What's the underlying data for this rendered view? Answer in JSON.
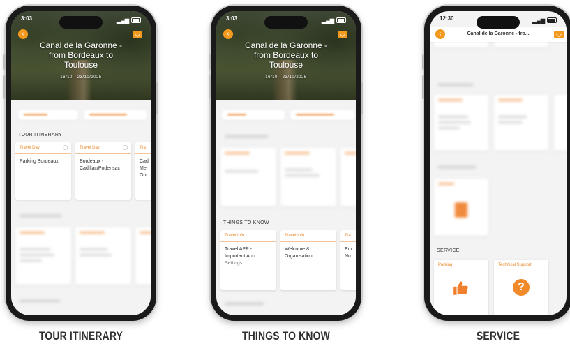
{
  "colors": {
    "accent": "#f39a1e",
    "card_head_text": "#e8892a",
    "caption": "#2f2f2f"
  },
  "phones": [
    {
      "status_time": "3:03",
      "hero_title": "Canal de la Garonne - from Bordeaux to Toulouse",
      "hero_dates": "16/10 - 23/10/2025",
      "section_label": "TOUR ITINERARY",
      "cards": [
        {
          "head": "Travel Day",
          "body": "Parking Bordeaux",
          "sub": ""
        },
        {
          "head": "Travel Day",
          "body": "Bordeaux - Cadillac/Podensac",
          "sub": ""
        },
        {
          "head": "Tra",
          "body": "Cad Mei Gor",
          "sub": ""
        }
      ],
      "caption": "TOUR ITINERARY"
    },
    {
      "status_time": "3:03",
      "hero_title": "Canal de la Garonne - from Bordeaux to Toulouse",
      "hero_dates": "16/10 - 23/10/2025",
      "section_label": "THINGS TO KNOW",
      "cards": [
        {
          "head": "Travel Info",
          "body": "Travel APP - Important App",
          "sub": "Settings"
        },
        {
          "head": "Travel Info",
          "body": "Welcome & Organisation",
          "sub": ""
        },
        {
          "head": "Tra",
          "body": "Em Nu",
          "sub": ""
        }
      ],
      "caption": "THINGS TO KNOW"
    },
    {
      "status_time": "12:30",
      "header_title": "Canal de la Garonne - fro...",
      "section_label": "SERVICE",
      "cards": [
        {
          "head": "Parking",
          "icon": "thumbs-up-icon"
        },
        {
          "head": "Technical Support",
          "icon": "question-icon"
        }
      ],
      "caption": "SERVICE"
    }
  ],
  "icons": {
    "back": "‹",
    "question": "?"
  }
}
